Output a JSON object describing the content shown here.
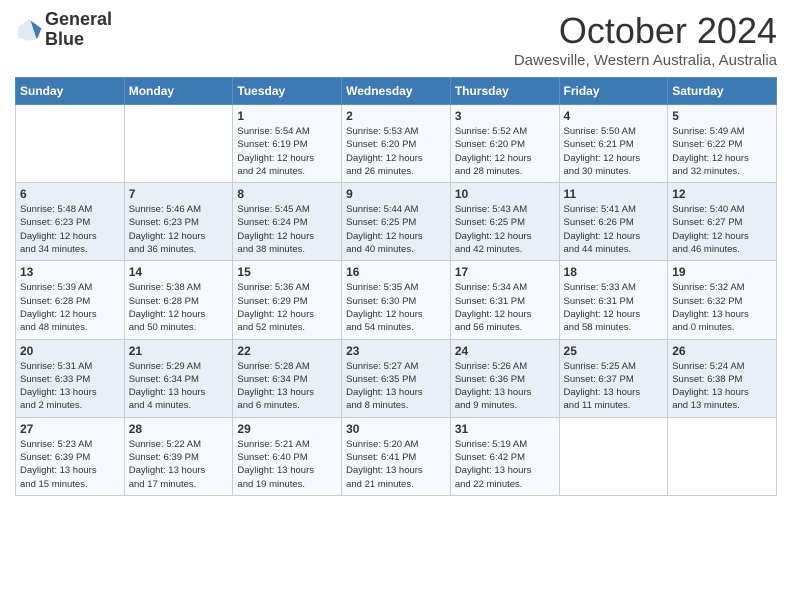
{
  "header": {
    "logo_line1": "General",
    "logo_line2": "Blue",
    "title": "October 2024",
    "subtitle": "Dawesville, Western Australia, Australia"
  },
  "days_of_week": [
    "Sunday",
    "Monday",
    "Tuesday",
    "Wednesday",
    "Thursday",
    "Friday",
    "Saturday"
  ],
  "weeks": [
    [
      {
        "day": "",
        "info": ""
      },
      {
        "day": "",
        "info": ""
      },
      {
        "day": "1",
        "info": "Sunrise: 5:54 AM\nSunset: 6:19 PM\nDaylight: 12 hours\nand 24 minutes."
      },
      {
        "day": "2",
        "info": "Sunrise: 5:53 AM\nSunset: 6:20 PM\nDaylight: 12 hours\nand 26 minutes."
      },
      {
        "day": "3",
        "info": "Sunrise: 5:52 AM\nSunset: 6:20 PM\nDaylight: 12 hours\nand 28 minutes."
      },
      {
        "day": "4",
        "info": "Sunrise: 5:50 AM\nSunset: 6:21 PM\nDaylight: 12 hours\nand 30 minutes."
      },
      {
        "day": "5",
        "info": "Sunrise: 5:49 AM\nSunset: 6:22 PM\nDaylight: 12 hours\nand 32 minutes."
      }
    ],
    [
      {
        "day": "6",
        "info": "Sunrise: 5:48 AM\nSunset: 6:23 PM\nDaylight: 12 hours\nand 34 minutes."
      },
      {
        "day": "7",
        "info": "Sunrise: 5:46 AM\nSunset: 6:23 PM\nDaylight: 12 hours\nand 36 minutes."
      },
      {
        "day": "8",
        "info": "Sunrise: 5:45 AM\nSunset: 6:24 PM\nDaylight: 12 hours\nand 38 minutes."
      },
      {
        "day": "9",
        "info": "Sunrise: 5:44 AM\nSunset: 6:25 PM\nDaylight: 12 hours\nand 40 minutes."
      },
      {
        "day": "10",
        "info": "Sunrise: 5:43 AM\nSunset: 6:25 PM\nDaylight: 12 hours\nand 42 minutes."
      },
      {
        "day": "11",
        "info": "Sunrise: 5:41 AM\nSunset: 6:26 PM\nDaylight: 12 hours\nand 44 minutes."
      },
      {
        "day": "12",
        "info": "Sunrise: 5:40 AM\nSunset: 6:27 PM\nDaylight: 12 hours\nand 46 minutes."
      }
    ],
    [
      {
        "day": "13",
        "info": "Sunrise: 5:39 AM\nSunset: 6:28 PM\nDaylight: 12 hours\nand 48 minutes."
      },
      {
        "day": "14",
        "info": "Sunrise: 5:38 AM\nSunset: 6:28 PM\nDaylight: 12 hours\nand 50 minutes."
      },
      {
        "day": "15",
        "info": "Sunrise: 5:36 AM\nSunset: 6:29 PM\nDaylight: 12 hours\nand 52 minutes."
      },
      {
        "day": "16",
        "info": "Sunrise: 5:35 AM\nSunset: 6:30 PM\nDaylight: 12 hours\nand 54 minutes."
      },
      {
        "day": "17",
        "info": "Sunrise: 5:34 AM\nSunset: 6:31 PM\nDaylight: 12 hours\nand 56 minutes."
      },
      {
        "day": "18",
        "info": "Sunrise: 5:33 AM\nSunset: 6:31 PM\nDaylight: 12 hours\nand 58 minutes."
      },
      {
        "day": "19",
        "info": "Sunrise: 5:32 AM\nSunset: 6:32 PM\nDaylight: 13 hours\nand 0 minutes."
      }
    ],
    [
      {
        "day": "20",
        "info": "Sunrise: 5:31 AM\nSunset: 6:33 PM\nDaylight: 13 hours\nand 2 minutes."
      },
      {
        "day": "21",
        "info": "Sunrise: 5:29 AM\nSunset: 6:34 PM\nDaylight: 13 hours\nand 4 minutes."
      },
      {
        "day": "22",
        "info": "Sunrise: 5:28 AM\nSunset: 6:34 PM\nDaylight: 13 hours\nand 6 minutes."
      },
      {
        "day": "23",
        "info": "Sunrise: 5:27 AM\nSunset: 6:35 PM\nDaylight: 13 hours\nand 8 minutes."
      },
      {
        "day": "24",
        "info": "Sunrise: 5:26 AM\nSunset: 6:36 PM\nDaylight: 13 hours\nand 9 minutes."
      },
      {
        "day": "25",
        "info": "Sunrise: 5:25 AM\nSunset: 6:37 PM\nDaylight: 13 hours\nand 11 minutes."
      },
      {
        "day": "26",
        "info": "Sunrise: 5:24 AM\nSunset: 6:38 PM\nDaylight: 13 hours\nand 13 minutes."
      }
    ],
    [
      {
        "day": "27",
        "info": "Sunrise: 5:23 AM\nSunset: 6:39 PM\nDaylight: 13 hours\nand 15 minutes."
      },
      {
        "day": "28",
        "info": "Sunrise: 5:22 AM\nSunset: 6:39 PM\nDaylight: 13 hours\nand 17 minutes."
      },
      {
        "day": "29",
        "info": "Sunrise: 5:21 AM\nSunset: 6:40 PM\nDaylight: 13 hours\nand 19 minutes."
      },
      {
        "day": "30",
        "info": "Sunrise: 5:20 AM\nSunset: 6:41 PM\nDaylight: 13 hours\nand 21 minutes."
      },
      {
        "day": "31",
        "info": "Sunrise: 5:19 AM\nSunset: 6:42 PM\nDaylight: 13 hours\nand 22 minutes."
      },
      {
        "day": "",
        "info": ""
      },
      {
        "day": "",
        "info": ""
      }
    ]
  ]
}
